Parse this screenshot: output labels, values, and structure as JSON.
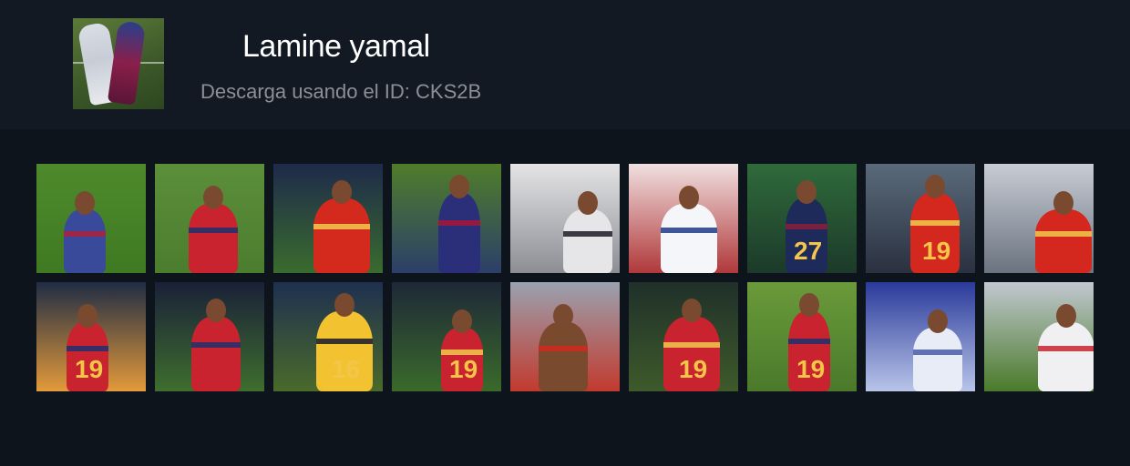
{
  "header": {
    "title": "Lamine yamal",
    "subtitle": "Descarga usando el ID: CKS2B"
  },
  "thumbnails": [
    {
      "name": "clip-1",
      "bg": [
        "#4e8a2c",
        "#3f7a22"
      ],
      "figure": "#3a4a9a",
      "accent": "#b0203a"
    },
    {
      "name": "clip-2",
      "bg": [
        "#5c8f3a",
        "#4b7d2e"
      ],
      "figure": "#c8232e",
      "accent": "#1f2f6e"
    },
    {
      "name": "clip-3",
      "bg": [
        "#1e2a4a",
        "#3a6b2e"
      ],
      "figure": "#d42a1e",
      "accent": "#f2c94c"
    },
    {
      "name": "clip-4",
      "bg": [
        "#4f7d2a",
        "#2c3f6a"
      ],
      "figure": "#2b2f7a",
      "accent": "#a8163a"
    },
    {
      "name": "clip-5",
      "bg": [
        "#e4e4e6",
        "#8c8e94"
      ],
      "figure": "#e6e6e8",
      "accent": "#1b1b24"
    },
    {
      "name": "clip-6",
      "bg": [
        "#f0e0e0",
        "#b0383a"
      ],
      "figure": "#f4f6fa",
      "accent": "#203a8a"
    },
    {
      "name": "clip-7",
      "bg": [
        "#2f6a3a",
        "#1c3a2a"
      ],
      "figure": "#1e2a5a",
      "accent": "#8a1e3a",
      "number": "27"
    },
    {
      "name": "clip-8",
      "bg": [
        "#5a6a7a",
        "#2a3140"
      ],
      "figure": "#d4281e",
      "accent": "#f2c94c",
      "number": "19"
    },
    {
      "name": "clip-9",
      "bg": [
        "#c8ccd4",
        "#6a7380"
      ],
      "figure": "#d4281e",
      "accent": "#f2c94c"
    },
    {
      "name": "clip-10",
      "bg": [
        "#1f2c44",
        "#e39a3a"
      ],
      "figure": "#c8232e",
      "accent": "#1f2f6e",
      "number": "19"
    },
    {
      "name": "clip-11",
      "bg": [
        "#1a2038",
        "#3e6e2e"
      ],
      "figure": "#c8232e",
      "accent": "#1f2f6e"
    },
    {
      "name": "clip-12",
      "bg": [
        "#1e3050",
        "#4a6a2a"
      ],
      "figure": "#f2c230",
      "accent": "#1a1a2a",
      "number": "16"
    },
    {
      "name": "clip-13",
      "bg": [
        "#1e2838",
        "#3a6a2a"
      ],
      "figure": "#c8232e",
      "accent": "#f2c94c",
      "number": "19"
    },
    {
      "name": "clip-14",
      "bg": [
        "#9aa2b0",
        "#c23a2e"
      ],
      "figure": "#7a4a2e",
      "accent": "#d4281e"
    },
    {
      "name": "clip-15",
      "bg": [
        "#20302a",
        "#3e5a2a"
      ],
      "figure": "#c8232e",
      "accent": "#f2c94c",
      "number": "19"
    },
    {
      "name": "clip-16",
      "bg": [
        "#6a9a3a",
        "#4a7a2a"
      ],
      "figure": "#c8232e",
      "accent": "#1f2f6e",
      "number": "19"
    },
    {
      "name": "clip-17",
      "bg": [
        "#2a3a9a",
        "#b8c4e8"
      ],
      "figure": "#e8ecf6",
      "accent": "#4a5aa8"
    },
    {
      "name": "clip-18",
      "bg": [
        "#c2c8d0",
        "#4a7a2a"
      ],
      "figure": "#f0f0f2",
      "accent": "#c8232e"
    }
  ]
}
